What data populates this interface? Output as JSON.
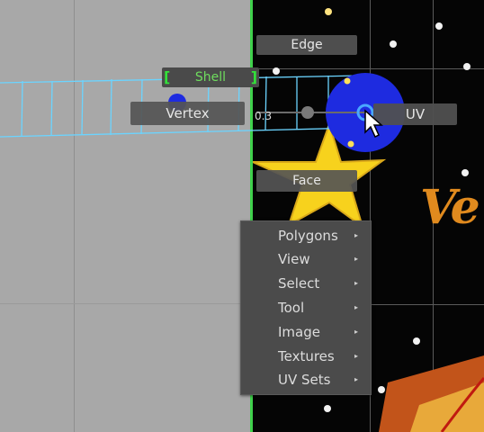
{
  "marking_menu": {
    "edge": "Edge",
    "shell": "Shell",
    "vertex": "Vertex",
    "face": "Face",
    "uv": "UV",
    "value_readout": "0.3"
  },
  "context_menu": {
    "items": [
      {
        "label": "Polygons"
      },
      {
        "label": "View"
      },
      {
        "label": "Select"
      },
      {
        "label": "Tool"
      },
      {
        "label": "Image"
      },
      {
        "label": "Textures"
      },
      {
        "label": "UV Sets"
      }
    ]
  },
  "texture": {
    "partial_text": "Ve"
  },
  "colors": {
    "selection_wire": "#6bd4ff",
    "active_green": "#33e23a",
    "uv_highlight": "#1e2be0",
    "star_yellow": "#f5d020",
    "texture_text_orange": "#e08a1e"
  }
}
